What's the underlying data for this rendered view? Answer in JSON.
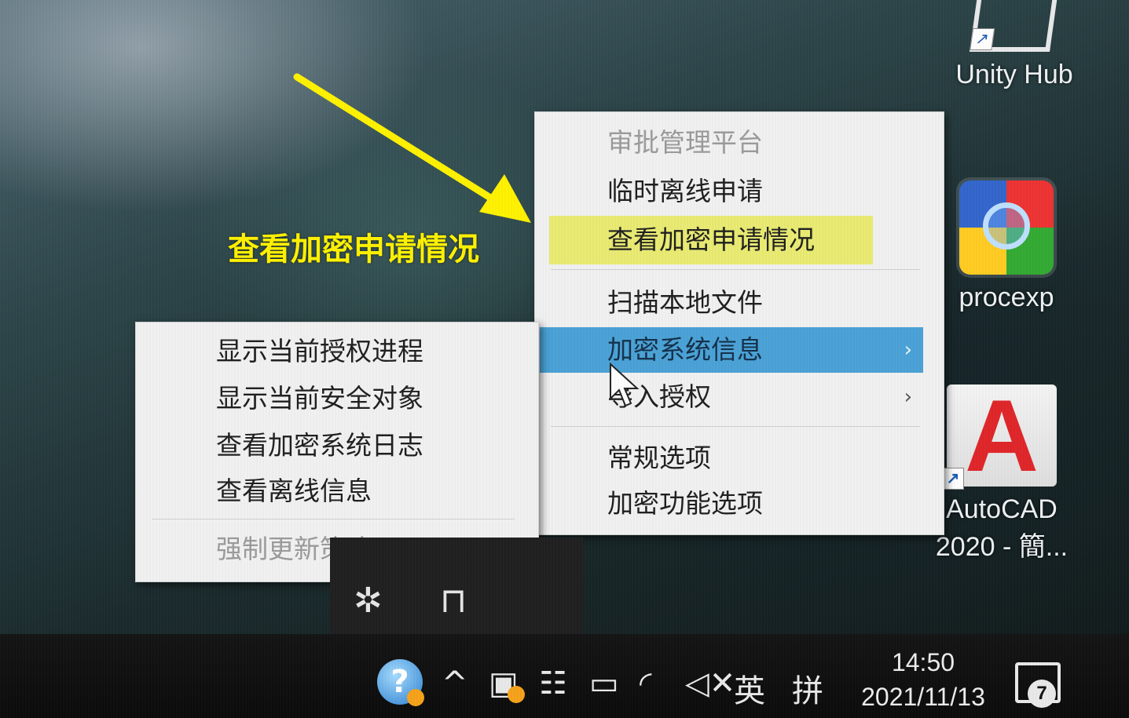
{
  "annotation": {
    "label": "查看加密申请情况",
    "color": "#fff200"
  },
  "desktop_icons": {
    "unity": {
      "label": "Unity Hub",
      "icon": "unity-hub-icon"
    },
    "procexp": {
      "label": "procexp",
      "icon": "process-explorer-icon"
    },
    "autocad": {
      "label_line1": "AutoCAD",
      "label_line2": "2020 - 簡...",
      "glyph": "A",
      "icon": "autocad-icon"
    }
  },
  "main_menu": {
    "items": [
      {
        "label": "审批管理平台",
        "state": "disabled"
      },
      {
        "label": "临时离线申请",
        "state": "normal"
      },
      {
        "label": "查看加密申请情况",
        "state": "highlighted"
      },
      {
        "label": "扫描本地文件",
        "state": "normal"
      },
      {
        "label": "加密系统信息",
        "state": "active",
        "submenu": true,
        "chevron": "›"
      },
      {
        "label": "导入授权",
        "state": "normal",
        "submenu": true,
        "chevron": "›"
      },
      {
        "label": "常规选项",
        "state": "normal"
      },
      {
        "label": "加密功能选项",
        "state": "normal"
      }
    ],
    "highlight_color": "#e8ea5c",
    "active_color": "#4aa2d6"
  },
  "sub_menu": {
    "items": [
      {
        "label": "显示当前授权进程",
        "state": "normal"
      },
      {
        "label": "显示当前安全对象",
        "state": "normal"
      },
      {
        "label": "查看加密系统日志",
        "state": "normal"
      },
      {
        "label": "查看离线信息",
        "state": "normal"
      },
      {
        "label": "强制更新策略",
        "state": "disabled"
      }
    ]
  },
  "tray_overflow": {
    "icons": [
      "unity-tray-icon",
      "bookmark-tray-icon"
    ]
  },
  "taskbar": {
    "help_glyph": "?",
    "chevron_up": "^",
    "ime_lang": "英",
    "ime_mode": "拼",
    "time": "14:50",
    "date": "2021/11/13",
    "notification_count": "7"
  }
}
